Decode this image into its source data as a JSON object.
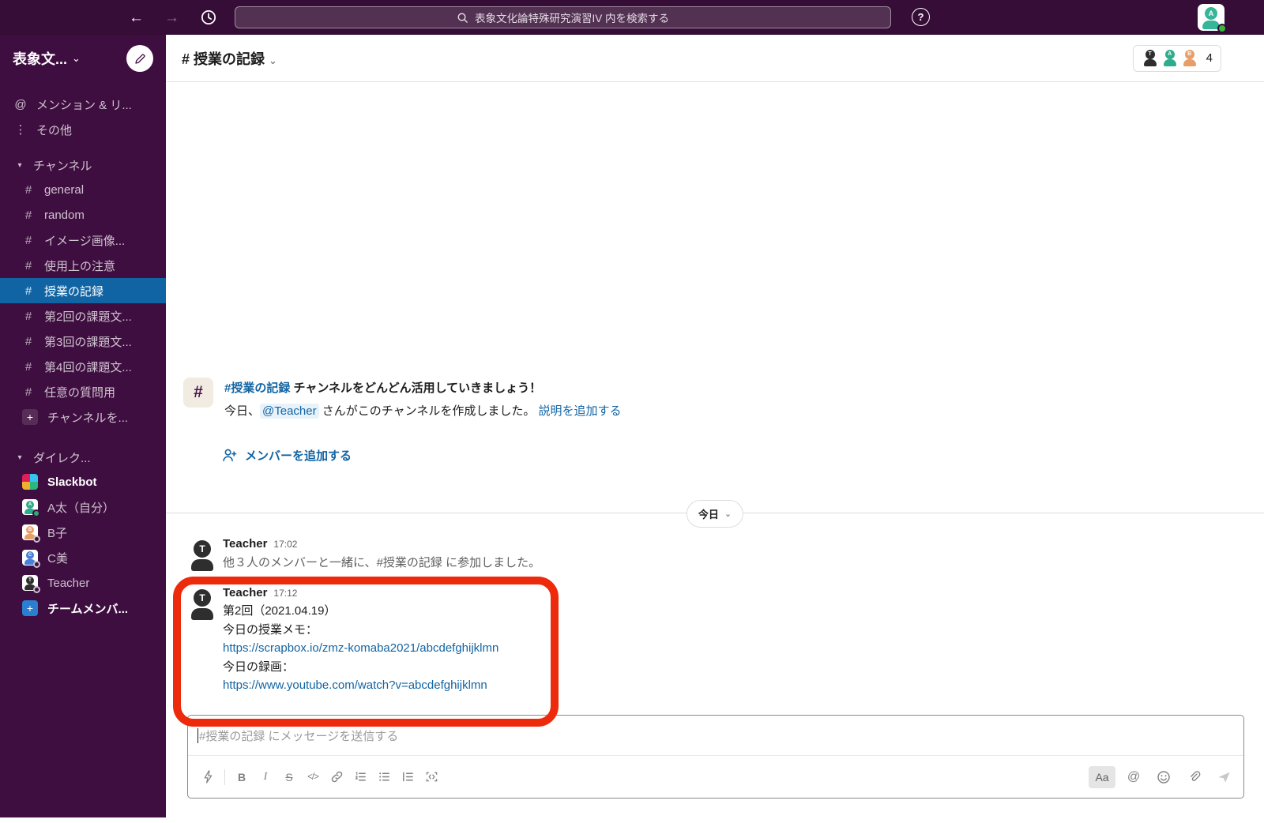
{
  "topbar": {
    "search_placeholder": "表象文化論特殊研究演習IV 内を検索する"
  },
  "icons": {
    "back": "←",
    "forward": "→",
    "help": "?",
    "chevron_down": "⌄",
    "caret_down": "▾",
    "hash": "#",
    "at": "@",
    "dots_vertical": "⋮",
    "plus": "+"
  },
  "user": {
    "initial": "A"
  },
  "sidebar": {
    "workspace_name": "表象文...",
    "mentions_label": "メンション & リ...",
    "more_label": "その他",
    "channels_header": "チャンネル",
    "channels": [
      "general",
      "random",
      "イメージ画像...",
      "使用上の注意",
      "授業の記録",
      "第2回の課題文...",
      "第3回の課題文...",
      "第4回の課題文...",
      "任意の質問用"
    ],
    "selected_channel": "授業の記録",
    "add_channel_label": "チャンネルを...",
    "dm_header": "ダイレク...",
    "dms": [
      {
        "name": "Slackbot",
        "type": "slackbot"
      },
      {
        "name": "A太（自分）",
        "initial": "A",
        "color": "#2FAC8E",
        "online": true
      },
      {
        "name": "B子",
        "initial": "B",
        "color": "#E89E68",
        "online": false
      },
      {
        "name": "C美",
        "initial": "C",
        "color": "#4A7FD6",
        "online": false
      },
      {
        "name": "Teacher",
        "initial": "T",
        "color": "#2E2E2E",
        "online": false
      }
    ],
    "invite_label": "チームメンバ..."
  },
  "header": {
    "channel_title": "# 授業の記録",
    "member_avatars": [
      {
        "initial": "T",
        "color": "#2E2E2E"
      },
      {
        "initial": "A",
        "color": "#2FAC8E"
      },
      {
        "initial": "B",
        "color": "#E89E68"
      }
    ],
    "member_count": "4"
  },
  "intro": {
    "title_channel_link": "#授業の記録",
    "title_rest": " チャンネルをどんどん活用していきましょう！",
    "created_pre": "今日、",
    "created_mention": "@Teacher",
    "created_post": " さんがこのチャンネルを作成しました。 ",
    "add_description_link": "説明を追加する",
    "add_members_label": "メンバーを追加する"
  },
  "date_divider": {
    "label": "今日"
  },
  "messages": [
    {
      "author": "Teacher",
      "initial": "T",
      "time": "17:02",
      "system_pre": "他３人のメンバーと一緒に、",
      "system_channel": "#授業の記録",
      "system_post": " に参加しました。"
    },
    {
      "author": "Teacher",
      "initial": "T",
      "time": "17:12",
      "lines": [
        "第2回（2021.04.19）",
        "今日の授業メモ：",
        "https://scrapbox.io/zmz-komaba2021/abcdefghijklmn",
        "今日の録画：",
        "https://www.youtube.com/watch?v=abcdefghijklmn"
      ],
      "link_indices": [
        2,
        4
      ]
    }
  ],
  "highlight": {
    "color": "#EE2A0D"
  },
  "composer": {
    "placeholder": "#授業の記録 にメッセージを送信する",
    "bold_label": "B",
    "italic_label": "I",
    "strike_label": "S",
    "code_label": "</>",
    "aa_label": "Aa",
    "at_label": "@"
  },
  "colors": {
    "topbar_bg": "#350D36",
    "sidebar_bg": "#3F0E40",
    "selected_channel_bg": "#1164A3",
    "link": "#1264A3",
    "presence_green": "#2BAC76",
    "highlight_red": "#EE2A0D"
  }
}
